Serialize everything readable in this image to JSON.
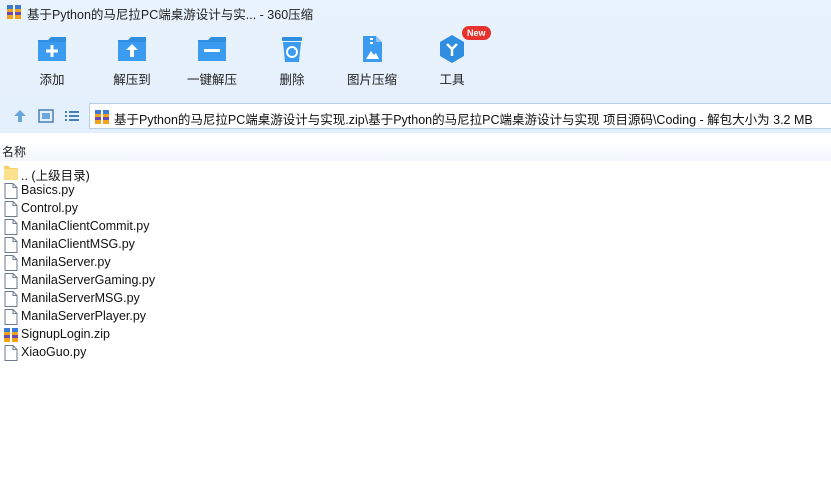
{
  "window": {
    "title": "基于Python的马尼拉PC端桌游设计与实... - 360压缩"
  },
  "toolbar": {
    "items": [
      {
        "label": "添加",
        "icon": "add-folder-icon"
      },
      {
        "label": "解压到",
        "icon": "extract-to-icon"
      },
      {
        "label": "一键解压",
        "icon": "one-click-extract-icon"
      },
      {
        "label": "删除",
        "icon": "recycle-bin-icon"
      },
      {
        "label": "图片压缩",
        "icon": "image-compress-icon"
      },
      {
        "label": "工具",
        "icon": "tools-icon",
        "badge": "New"
      }
    ]
  },
  "address": {
    "path": "基于Python的马尼拉PC端桌游设计与实现.zip\\基于Python的马尼拉PC端桌游设计与实现 项目源码\\Coding - 解包大小为 3.2 MB"
  },
  "list": {
    "column_name": "名称",
    "files": [
      {
        "name": ".. (上级目录)",
        "type": "folder"
      },
      {
        "name": "Basics.py",
        "type": "file"
      },
      {
        "name": "Control.py",
        "type": "file"
      },
      {
        "name": "ManilaClientCommit.py",
        "type": "file"
      },
      {
        "name": "ManilaClientMSG.py",
        "type": "file"
      },
      {
        "name": "ManilaServer.py",
        "type": "file"
      },
      {
        "name": "ManilaServerGaming.py",
        "type": "file"
      },
      {
        "name": "ManilaServerMSG.py",
        "type": "file"
      },
      {
        "name": "ManilaServerPlayer.py",
        "type": "file"
      },
      {
        "name": "SignupLogin.zip",
        "type": "zip"
      },
      {
        "name": "XiaoGuo.py",
        "type": "file"
      }
    ]
  },
  "colors": {
    "accent": "#2f8ee0",
    "toolbar_bg": "#e6f1fc",
    "badge": "#e8322e"
  }
}
